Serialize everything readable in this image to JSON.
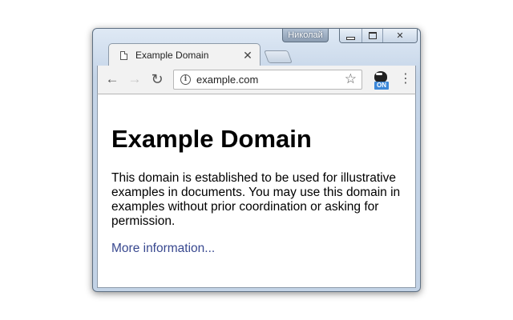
{
  "window": {
    "profile_name": "Николай"
  },
  "tab": {
    "title": "Example Domain",
    "favicon": "page-icon",
    "close_glyph": "✕"
  },
  "toolbar": {
    "back_glyph": "←",
    "forward_glyph": "→",
    "reload_glyph": "↻",
    "url": "example.com",
    "info_glyph": "i",
    "star_glyph": "☆",
    "extension_badge": "ON",
    "menu_glyph": "⋮"
  },
  "page": {
    "heading": "Example Domain",
    "paragraph": "This domain is established to be used for illustrative examples in documents. You may use this domain in examples without prior coordination or asking for permission.",
    "link_text": "More information...",
    "link_color": "#38488f"
  }
}
